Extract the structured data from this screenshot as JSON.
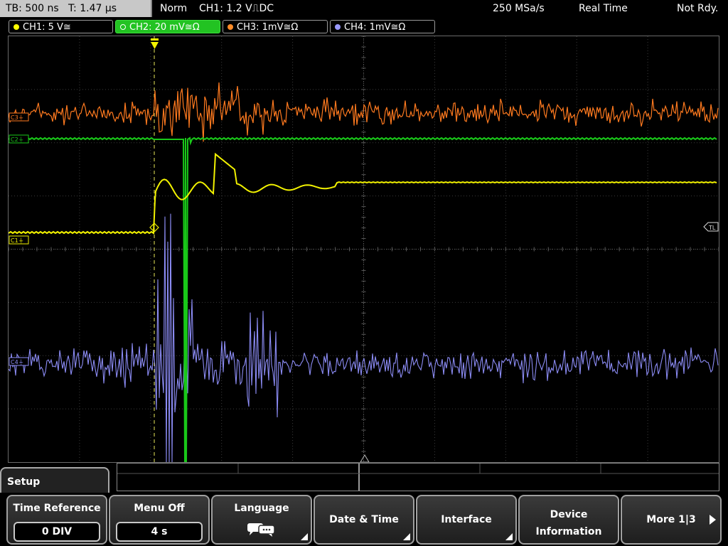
{
  "topbar": {
    "tb": "TB: 500 ns",
    "t": "T: 1.47 µs",
    "mode": "Norm",
    "trigger": "CH1: 1.2 V",
    "trigger_cfg": "⎍DC",
    "sample_rate": "250 MSa/s",
    "acq": "Real Time",
    "status": "Not Rdy."
  },
  "channels": [
    {
      "label": "CH1: 5 V≅",
      "color": "#ffff00"
    },
    {
      "label": "CH2: 20 mV≅Ω",
      "color": "#22c322"
    },
    {
      "label": "CH3: 1mV≅Ω",
      "color": "#ff8c28"
    },
    {
      "label": "CH4: 1mV≅Ω",
      "color": "#9999ff"
    }
  ],
  "markers": {
    "c1": "C1⏚",
    "c2": "C2⏚",
    "c3": "C3⏚",
    "c4": "C4⏚",
    "tl": "TL"
  },
  "colors": {
    "ch1": "#f2f200",
    "ch2": "#19c819",
    "ch3": "#ff7a1f",
    "ch4": "#8c8cf5",
    "grid": "#4a4a4a"
  },
  "menu": {
    "tab": "Setup",
    "time_reference": {
      "label": "Time Reference",
      "value": "0 DIV"
    },
    "menu_off": {
      "label": "Menu Off",
      "value": "4 s"
    },
    "language": {
      "label": "Language",
      "icon": "speech-bubbles-icon"
    },
    "date_time": "Date & Time",
    "interface": "Interface",
    "device_information": {
      "line1": "Device",
      "line2": "Information"
    },
    "more": "More 1|3"
  }
}
